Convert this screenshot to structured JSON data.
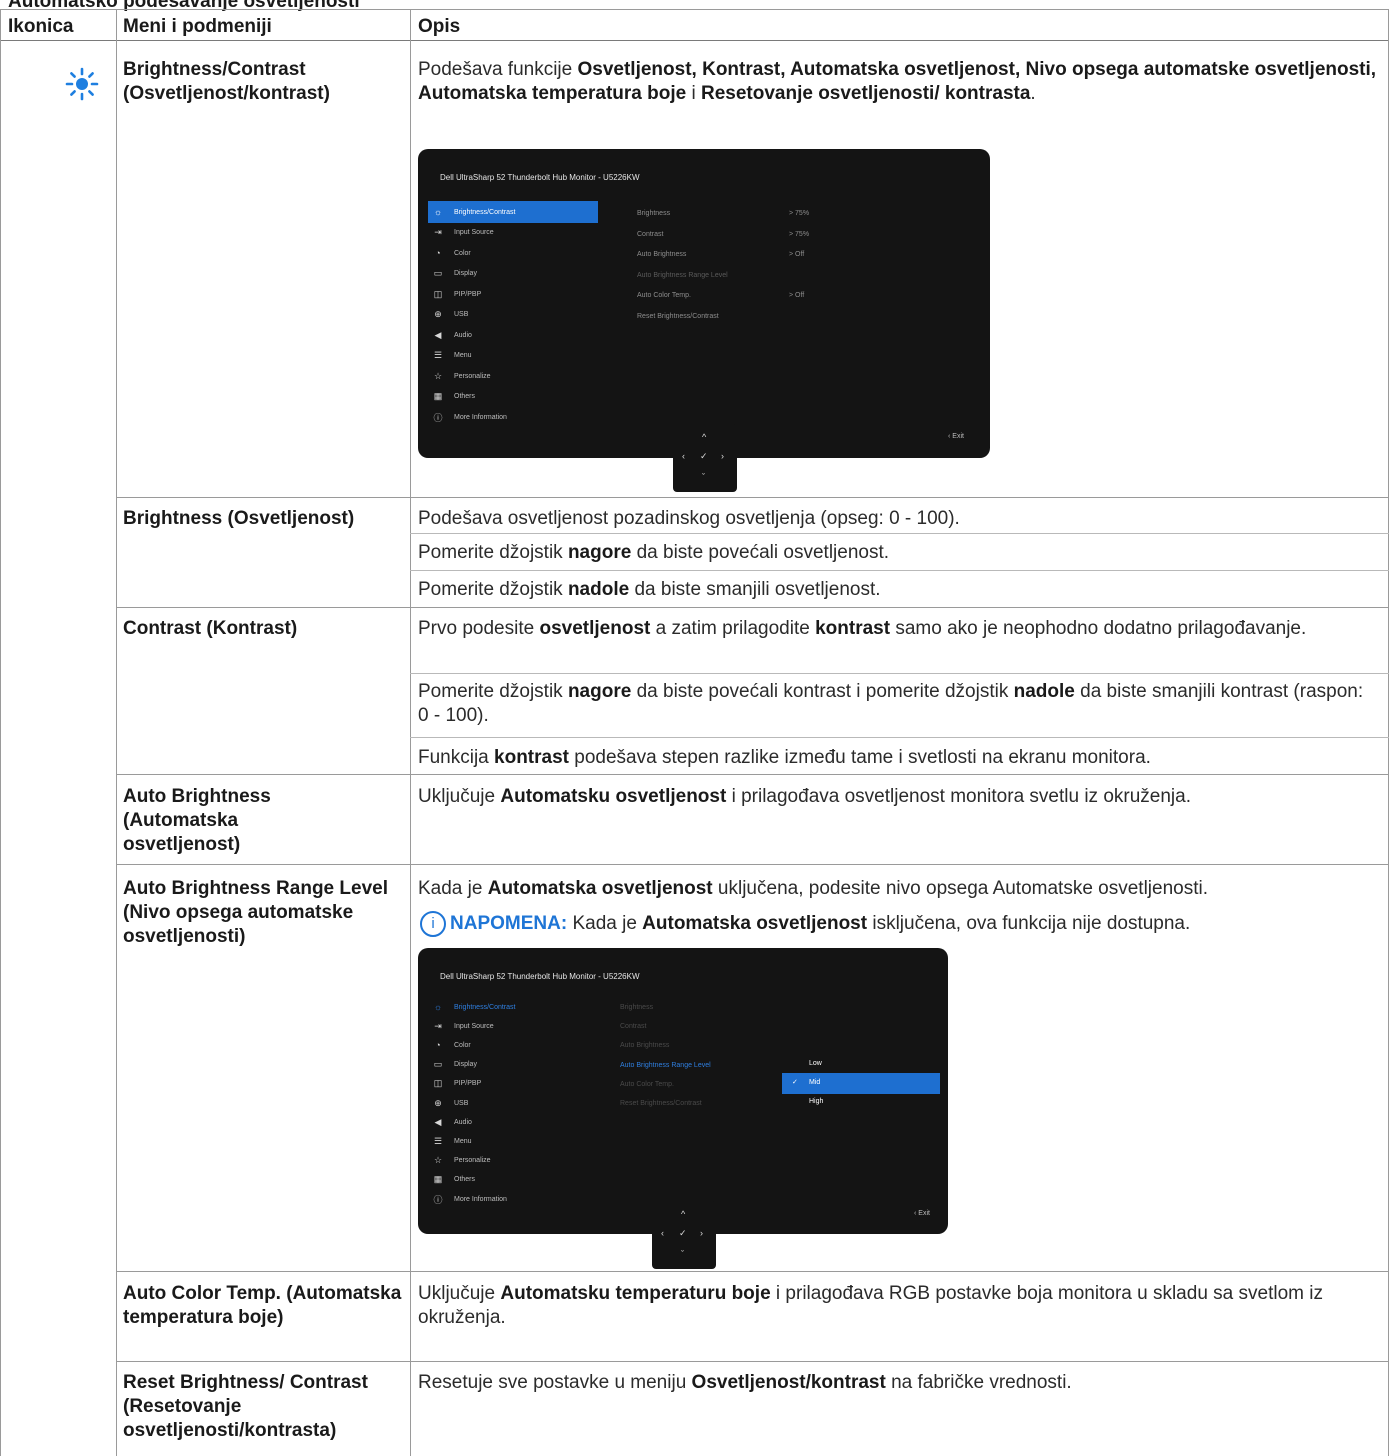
{
  "caption": "Automatsko podešavanje osvetljenosti",
  "headers": {
    "icon": "Ikonica",
    "menu": "Meni i podmeniji",
    "desc": "Opis"
  },
  "rows": {
    "bc": {
      "menu": "Brightness/Contrast (Osvetljenost/kontrast)",
      "desc_parts": [
        "Podešava funkcije ",
        "Osvetljenost, Kontrast, Automatska osvetljenost, Nivo opsega automatske osvetljenosti, Automatska temperatura boje",
        " i ",
        "Resetovanje osvetljenosti/ kontrasta",
        "."
      ]
    },
    "brightness": {
      "menu": "Brightness (Osvetljenost)",
      "l1": "Podešava osvetljenost pozadinskog osvetljenja (opseg: 0 - 100).",
      "l2": [
        "Pomerite džojstik ",
        "nagore",
        " da biste povećali osvetljenost."
      ],
      "l3": [
        "Pomerite džojstik ",
        "nadole",
        " da biste smanjili osvetljenost."
      ]
    },
    "contrast": {
      "menu": "Contrast (Kontrast)",
      "p1": [
        "Prvo podesite ",
        "osvetljenost",
        " a zatim prilagodite ",
        "kontrast",
        " samo ako je neophodno dodatno prilagođavanje."
      ],
      "p2": [
        "Pomerite džojstik ",
        "nagore",
        " da biste povećali kontrast i pomerite džojstik ",
        "nadole",
        " da biste smanjili kontrast (raspon: 0 - 100)."
      ],
      "p3": [
        "Funkcija ",
        "kontrast",
        " podešava stepen razlike između tame i svetlosti na ekranu monitora."
      ]
    },
    "auto_brightness": {
      "menu": "Auto Brightness (Automatska osvetljenost)",
      "p": [
        "Uključuje ",
        "Automatsku osvetljenost",
        " i prilagođava osvetljenost monitora svetlu iz okruženja."
      ]
    },
    "range": {
      "menu": "Auto Brightness Range Level (Nivo opsega automatske osvetljenosti)",
      "p": [
        "Kada je ",
        "Automatska osvetljenost",
        " uključena, podesite nivo opsega Automatske osvetljenosti."
      ],
      "note_icon": "i",
      "note_label": "NAPOMENA:",
      "note": [
        " Kada je ",
        "Automatska osvetljenost",
        " isključena, ova funkcija nije dostupna."
      ]
    },
    "color_temp": {
      "menu": "Auto Color Temp. (Automatska temperatura boje)",
      "p": [
        "Uključuje ",
        "Automatsku temperaturu boje",
        " i prilagođava RGB postavke boja monitora u skladu sa svetlom iz okruženja."
      ]
    },
    "reset": {
      "menu": "Reset Brightness/ Contrast (Resetovanje osvetljenosti/kontrasta)",
      "p": [
        "Resetuje sve postavke u meniju ",
        "Osvetljenost/kontrast",
        " na fabričke vrednosti."
      ]
    }
  },
  "osd1": {
    "title": "Dell UltraSharp 52 Thunderbolt Hub Monitor - U5226KW",
    "menu": [
      {
        "icon": "☼",
        "label": "Brightness/Contrast"
      },
      {
        "icon": "⇥",
        "label": "Input Source"
      },
      {
        "icon": "◔",
        "label": "Color"
      },
      {
        "icon": "▭",
        "label": "Display"
      },
      {
        "icon": "◫",
        "label": "PIP/PBP"
      },
      {
        "icon": "⊕",
        "label": "USB"
      },
      {
        "icon": "◀",
        "label": "Audio"
      },
      {
        "icon": "☰",
        "label": "Menu"
      },
      {
        "icon": "☆",
        "label": "Personalize"
      },
      {
        "icon": "▦",
        "label": "Others"
      },
      {
        "icon": "ⓘ",
        "label": "More Information"
      }
    ],
    "sub": [
      "Brightness",
      "Contrast",
      "Auto Brightness",
      "Auto Brightness Range Level",
      "Auto Color Temp.",
      "Reset Brightness/Contrast"
    ],
    "vals": [
      "> 75%",
      "> 75%",
      "> Off",
      "",
      "> Off",
      ""
    ],
    "exit": "‹  Exit",
    "joy": {
      "up": "^",
      "left": "‹",
      "ok": "✓",
      "right": "›",
      "down": "ˇ"
    }
  },
  "osd2": {
    "title": "Dell UltraSharp 52 Thunderbolt Hub Monitor - U5226KW",
    "sub": [
      "Brightness",
      "Contrast",
      "Auto Brightness",
      "Auto Brightness Range Level",
      "Auto Color Temp.",
      "Reset Brightness/Contrast"
    ],
    "options": [
      "Low",
      "Mid",
      "High"
    ],
    "selected_option": "Mid",
    "check": "✓",
    "exit": "‹  Exit"
  },
  "colors": {
    "accent": "#1e75d6",
    "osd_bg": "#141414",
    "highlight": "#1e6fd0",
    "sun": "#1e7fe0"
  }
}
